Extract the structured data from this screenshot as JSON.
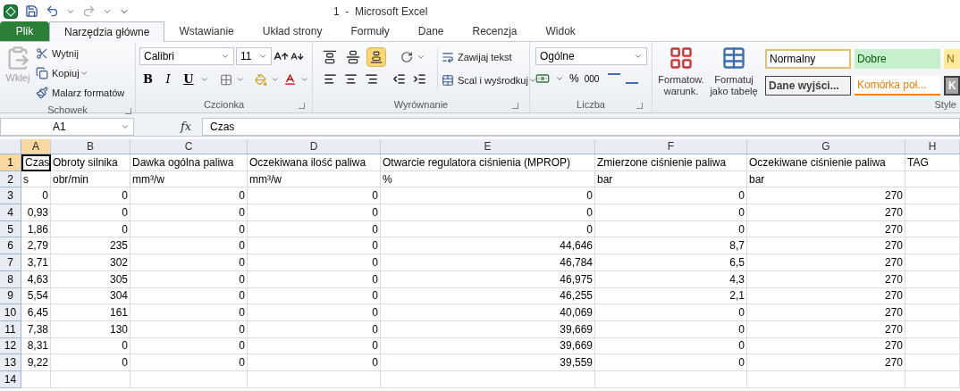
{
  "window": {
    "title": "1  -  Microsoft Excel"
  },
  "tabs": [
    {
      "label": "Plik",
      "kind": "file",
      "selected": false
    },
    {
      "label": "Narzędzia główne",
      "kind": "tab",
      "selected": true
    },
    {
      "label": "Wstawianie",
      "kind": "tab",
      "selected": false
    },
    {
      "label": "Układ strony",
      "kind": "tab",
      "selected": false
    },
    {
      "label": "Formuły",
      "kind": "tab",
      "selected": false
    },
    {
      "label": "Dane",
      "kind": "tab",
      "selected": false
    },
    {
      "label": "Recenzja",
      "kind": "tab",
      "selected": false
    },
    {
      "label": "Widok",
      "kind": "tab",
      "selected": false
    }
  ],
  "ribbon": {
    "clipboard": {
      "paste": {
        "label": "Wklej",
        "disabled": true
      },
      "cut": "Wytnij",
      "copy": "Kopiuj",
      "painter": "Malarz formatów",
      "label": "Schowek"
    },
    "font": {
      "name": "Calibri",
      "size": "11",
      "bold": "B",
      "italic": "I",
      "underline": "U",
      "label": "Czcionka"
    },
    "alignment": {
      "vertical": [
        {
          "kind": "top",
          "selected": false
        },
        {
          "kind": "middle",
          "selected": false
        },
        {
          "kind": "bottom",
          "selected": true
        }
      ],
      "wrap": "Zawijaj tekst",
      "merge": "Scal i wyśrodkuj",
      "label": "Wyrównanie"
    },
    "number": {
      "format": "Ogólne",
      "percent": "%",
      "thousands": "000",
      "label": "Liczba"
    },
    "styles": {
      "conditional": [
        "Formatow.",
        "warunk."
      ],
      "as_table": [
        "Formatuj",
        "jako tabelę"
      ],
      "cells": [
        {
          "label": "Normalny",
          "kind": "normal"
        },
        {
          "label": "Dobre",
          "kind": "good"
        },
        {
          "label": "N",
          "kind": "neutral"
        },
        {
          "label": "Dane wyjści...",
          "kind": "output"
        },
        {
          "label": "Komórka poł...",
          "kind": "linked"
        },
        {
          "label": "K",
          "kind": "check"
        }
      ],
      "label": "Style"
    }
  },
  "formula_bar": {
    "name_box": "A1",
    "function_label": "fx",
    "content": "Czas"
  },
  "sheet": {
    "columns": [
      {
        "label": "A",
        "selected": true
      },
      {
        "label": "B",
        "selected": false
      },
      {
        "label": "C",
        "selected": false
      },
      {
        "label": "D",
        "selected": false
      },
      {
        "label": "E",
        "selected": false
      },
      {
        "label": "F",
        "selected": false
      },
      {
        "label": "G",
        "selected": false
      },
      {
        "label": "H",
        "selected": false
      }
    ],
    "rows": [
      {
        "number": "1",
        "selected": true,
        "kind": "text",
        "cells": [
          "Czas",
          "Obroty silnika",
          "Dawka ogólna paliwa",
          "Oczekiwana ilość paliwa",
          "Otwarcie regulatora ciśnienia (MPROP)",
          "Zmierzone ciśnienie paliwa",
          "Oczekiwane ciśnienie paliwa",
          "TAG"
        ]
      },
      {
        "number": "2",
        "selected": false,
        "kind": "text",
        "cells": [
          "s",
          "obr/min",
          "mm³/w",
          "mm³/w",
          "%",
          "bar",
          "bar"
        ]
      },
      {
        "number": "3",
        "selected": false,
        "kind": "number",
        "cells": [
          "0",
          "0",
          "0",
          "0",
          "0",
          "0",
          "270"
        ]
      },
      {
        "number": "4",
        "selected": false,
        "kind": "number",
        "cells": [
          "0,93",
          "0",
          "0",
          "0",
          "0",
          "0",
          "270"
        ]
      },
      {
        "number": "5",
        "selected": false,
        "kind": "number",
        "cells": [
          "1,86",
          "0",
          "0",
          "0",
          "0",
          "0",
          "270"
        ]
      },
      {
        "number": "6",
        "selected": false,
        "kind": "number",
        "cells": [
          "2,79",
          "235",
          "0",
          "0",
          "44,646",
          "8,7",
          "270"
        ]
      },
      {
        "number": "7",
        "selected": false,
        "kind": "number",
        "cells": [
          "3,71",
          "302",
          "0",
          "0",
          "46,784",
          "6,5",
          "270"
        ]
      },
      {
        "number": "8",
        "selected": false,
        "kind": "number",
        "cells": [
          "4,63",
          "305",
          "0",
          "0",
          "46,975",
          "4,3",
          "270"
        ]
      },
      {
        "number": "9",
        "selected": false,
        "kind": "number",
        "cells": [
          "5,54",
          "304",
          "0",
          "0",
          "46,255",
          "2,1",
          "270"
        ]
      },
      {
        "number": "10",
        "selected": false,
        "kind": "number",
        "cells": [
          "6,45",
          "161",
          "0",
          "0",
          "40,069",
          "0",
          "270"
        ]
      },
      {
        "number": "11",
        "selected": false,
        "kind": "number",
        "cells": [
          "7,38",
          "130",
          "0",
          "0",
          "39,669",
          "0",
          "270"
        ]
      },
      {
        "number": "12",
        "selected": false,
        "kind": "number",
        "cells": [
          "8,31",
          "0",
          "0",
          "0",
          "39,669",
          "0",
          "270"
        ]
      },
      {
        "number": "13",
        "selected": false,
        "kind": "number",
        "cells": [
          "9,22",
          "0",
          "0",
          "0",
          "39,559",
          "0",
          "270"
        ]
      },
      {
        "number": "14",
        "selected": false,
        "kind": "empty"
      }
    ]
  }
}
